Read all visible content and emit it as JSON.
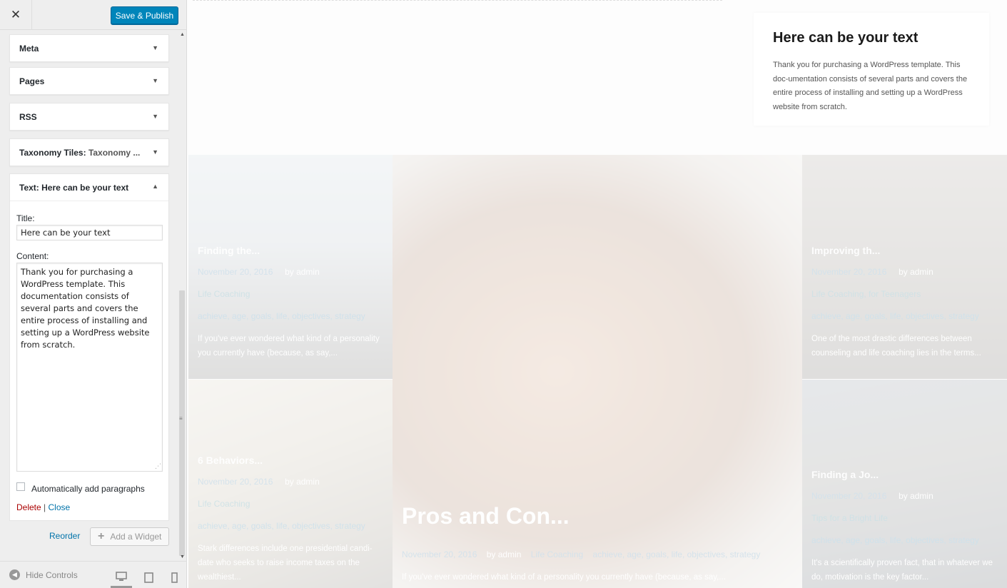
{
  "header": {
    "close_glyph": "✕",
    "publish_label": "Save & Publish"
  },
  "widgets": [
    {
      "title": "Meta",
      "sub": ""
    },
    {
      "title": "Pages",
      "sub": ""
    },
    {
      "title": "RSS",
      "sub": ""
    },
    {
      "title": "Taxonomy Tiles:",
      "sub": "Taxonomy ..."
    }
  ],
  "text_widget": {
    "title": "Text:",
    "sub": "Here can be your text",
    "title_label": "Title:",
    "title_value": "Here can be your text",
    "content_label": "Content:",
    "content_value": "Thank you for purchasing a WordPress template. This documentation consists of several parts and covers the entire process of installing and setting up a WordPress website from scratch.",
    "autop_label": "Automatically add paragraphs",
    "autop_checked": false,
    "delete_label": "Delete",
    "separator": "|",
    "close_label": "Close"
  },
  "actions": {
    "reorder_label": "Reorder",
    "add_widget_label": "Add a Widget"
  },
  "footer": {
    "hide_controls_label": "Hide Controls",
    "devices": [
      "desktop-icon",
      "tablet-icon",
      "mobile-icon"
    ],
    "active_device": "desktop"
  },
  "preview": {
    "card": {
      "title": "Here can be your text",
      "body": "Thank you for purchasing a WordPress template. This doc-umentation consists of several parts and covers the entire process of installing and setting up a WordPress website from scratch."
    },
    "tiles": [
      {
        "title": "Finding the...",
        "date": "November 20, 2016",
        "by": "by admin",
        "category": "Life Coaching",
        "tags": "achieve, age, goals, life, objectives, strategy",
        "excerpt": "If you've ever wondered what kind of a personality you currently have (because, as say,..."
      },
      {
        "title": "6 Behaviors...",
        "date": "November 20, 2016",
        "by": "by admin",
        "category": "Life Coaching",
        "tags": "achieve, age, goals, life, objectives, strategy",
        "excerpt": "Stark differences include one presidential candi-date who seeks to raise income taxes on the wealthiest..."
      },
      {
        "title": "Pros and Con...",
        "date": "November 20, 2016",
        "by": "by admin",
        "category": "Life Coaching",
        "tags": "achieve, age, goals, life, objectives, strategy",
        "excerpt": "If you've ever wondered what kind of a personality you currently have (because, as say,..."
      },
      {
        "title": "Improving th...",
        "date": "November 20, 2016",
        "by": "by admin",
        "category": "Life Coaching, for Teenagers",
        "tags": "achieve, age, goals, life, objectives, strategy",
        "excerpt": "One of the most drastic differences between counseling and life coaching lies in the terms..."
      },
      {
        "title": "Finding a Jo...",
        "date": "November 20, 2016",
        "by": "by admin",
        "category": "Tips for a Bright Life",
        "tags": "achieve, age, goals, life, objectives, strategy",
        "excerpt": "It's a scientifically proven fact, that in whatever we do, motivation is the key factor..."
      }
    ]
  }
}
